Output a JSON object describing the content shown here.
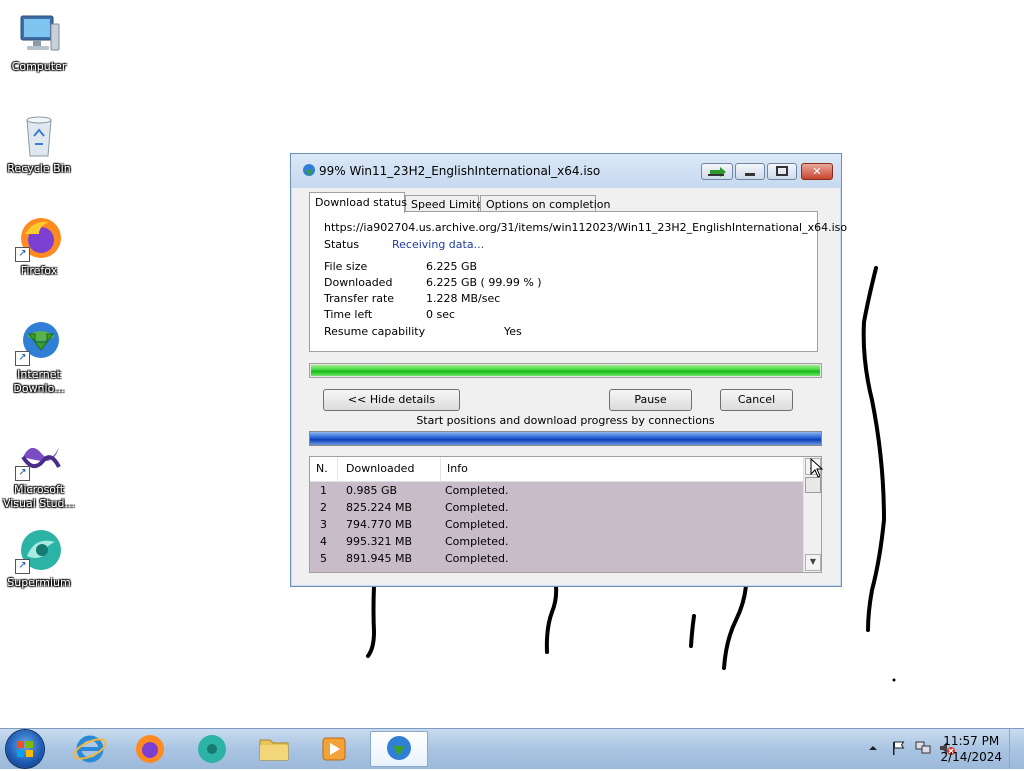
{
  "desktop": {
    "icons": [
      {
        "label": "Computer"
      },
      {
        "label": "Recycle Bin"
      },
      {
        "label": "Firefox"
      },
      {
        "label": "Internet Downlo..."
      },
      {
        "label": "Microsoft Visual Stud..."
      },
      {
        "label": "Supermium"
      }
    ]
  },
  "dialog": {
    "title": "99% Win11_23H2_EnglishInternational_x64.iso",
    "tabs": [
      "Download status",
      "Speed Limiter",
      "Options on completion"
    ],
    "url": "https://ia902704.us.archive.org/31/items/win112023/Win11_23H2_EnglishInternational_x64.iso",
    "status_label": "Status",
    "status_value": "Receiving data...",
    "fields": [
      {
        "label": "File size",
        "value": "6.225  GB"
      },
      {
        "label": "Downloaded",
        "value": "6.225  GB  ( 99.99 % )"
      },
      {
        "label": "Transfer rate",
        "value": "1.228  MB/sec"
      },
      {
        "label": "Time left",
        "value": "0 sec"
      },
      {
        "label": "Resume capability",
        "value": "Yes"
      }
    ],
    "progress_percent": 99.99,
    "buttons": {
      "hide_details": "<< Hide details",
      "pause": "Pause",
      "cancel": "Cancel"
    },
    "connections_caption": "Start positions and download progress by connections",
    "table": {
      "columns": [
        "N.",
        "Downloaded",
        "Info"
      ],
      "rows": [
        {
          "n": "1",
          "downloaded": "0.985  GB",
          "info": "Completed."
        },
        {
          "n": "2",
          "downloaded": "825.224  MB",
          "info": "Completed."
        },
        {
          "n": "3",
          "downloaded": "794.770  MB",
          "info": "Completed."
        },
        {
          "n": "4",
          "downloaded": "995.321  MB",
          "info": "Completed."
        },
        {
          "n": "5",
          "downloaded": "891.945  MB",
          "info": "Completed."
        }
      ]
    }
  },
  "taskbar": {
    "clock_time": "11:57 PM",
    "clock_date": "2/14/2024"
  }
}
